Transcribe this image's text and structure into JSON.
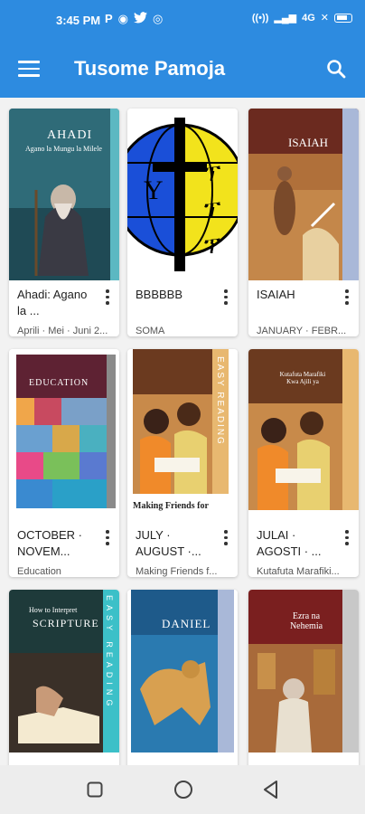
{
  "status_bar": {
    "time": "3:45 PM",
    "left_icons": [
      "P",
      "⊕",
      "🐦",
      "◎"
    ],
    "right_text": "4G"
  },
  "app_bar": {
    "title": "Tusome Pamoja",
    "menu_icon": "hamburger-menu-icon",
    "search_icon": "search-icon"
  },
  "books": [
    {
      "title": "Ahadi: Agano la ...",
      "subtitle": "Aprili · Mei · Juni 2...",
      "cover_title": "AHADI",
      "cover_subtitle": "Agano la Mungu la Milele"
    },
    {
      "title": "BBBBBB",
      "subtitle": "SOMA",
      "cover_title": "",
      "cover_subtitle": ""
    },
    {
      "title": "ISAIAH",
      "subtitle": "JANUARY · FEBR...",
      "cover_title": "ISAIAH",
      "cover_subtitle": ""
    },
    {
      "title": "OCTOBER · NOVEM...",
      "subtitle": "Education",
      "cover_title": "EDUCATION",
      "cover_subtitle": ""
    },
    {
      "title": "JULY · AUGUST ·...",
      "subtitle": "Making Friends f...",
      "cover_title": "Making Friends for",
      "cover_subtitle": "EASY READING"
    },
    {
      "title": "JULAI · AGOSTI · ...",
      "subtitle": "Kutafuta Marafiki...",
      "cover_title": "Kutafuta Marafiki Kwa Ajili ya",
      "cover_subtitle": ""
    },
    {
      "title": "",
      "subtitle": "",
      "cover_title": "SCRIPTURE",
      "cover_subtitle": "How to Interpret",
      "cover_side": "EASY READING"
    },
    {
      "title": "",
      "subtitle": "",
      "cover_title": "DANIEL",
      "cover_subtitle": ""
    },
    {
      "title": "",
      "subtitle": "",
      "cover_title": "Ezra na Nehemia",
      "cover_subtitle": ""
    }
  ],
  "nav_bar": {
    "buttons": [
      "recents-square-icon",
      "home-circle-icon",
      "back-triangle-icon"
    ]
  },
  "colors": {
    "app_bar": "#2d8be0",
    "background": "#f2f2f2"
  }
}
